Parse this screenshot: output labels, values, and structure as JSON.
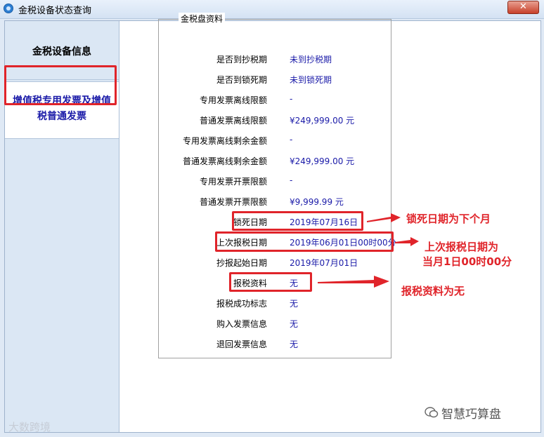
{
  "window": {
    "title": "金税设备状态查询",
    "close_label": "✕"
  },
  "sidebar": {
    "items": [
      {
        "label": "金税设备信息"
      },
      {
        "label": "增值税专用发票及增值税普通发票"
      }
    ]
  },
  "panel": {
    "group_title": "金税盘资料",
    "rows": [
      {
        "label": "是否到抄税期",
        "value": "未到抄税期"
      },
      {
        "label": "是否到锁死期",
        "value": "未到锁死期"
      },
      {
        "label": "专用发票离线限额",
        "value": "-"
      },
      {
        "label": "普通发票离线限额",
        "value": "¥249,999.00 元"
      },
      {
        "label": "专用发票离线剩余金额",
        "value": "-"
      },
      {
        "label": "普通发票离线剩余金额",
        "value": "¥249,999.00 元"
      },
      {
        "label": "专用发票开票限额",
        "value": "-"
      },
      {
        "label": "普通发票开票限额",
        "value": "¥9,999.99 元"
      },
      {
        "label": "锁死日期",
        "value": "2019年07月16日"
      },
      {
        "label": "上次报税日期",
        "value": "2019年06月01日00时00分"
      },
      {
        "label": "抄报起始日期",
        "value": "2019年07月01日"
      },
      {
        "label": "报税资料",
        "value": "无"
      },
      {
        "label": "报税成功标志",
        "value": "无"
      },
      {
        "label": "购入发票信息",
        "value": "无"
      },
      {
        "label": "退回发票信息",
        "value": "无"
      }
    ]
  },
  "annotations": {
    "lock_date": "锁死日期为下个月",
    "last_tax_line1": "上次报税日期为",
    "last_tax_line2": "当月1日00时00分",
    "tax_data": "报税资料为无"
  },
  "watermarks": {
    "left": "大数跨境",
    "right": "智慧巧算盘"
  },
  "colors": {
    "highlight": "#e0242a",
    "value_text": "#1a1aa8"
  }
}
